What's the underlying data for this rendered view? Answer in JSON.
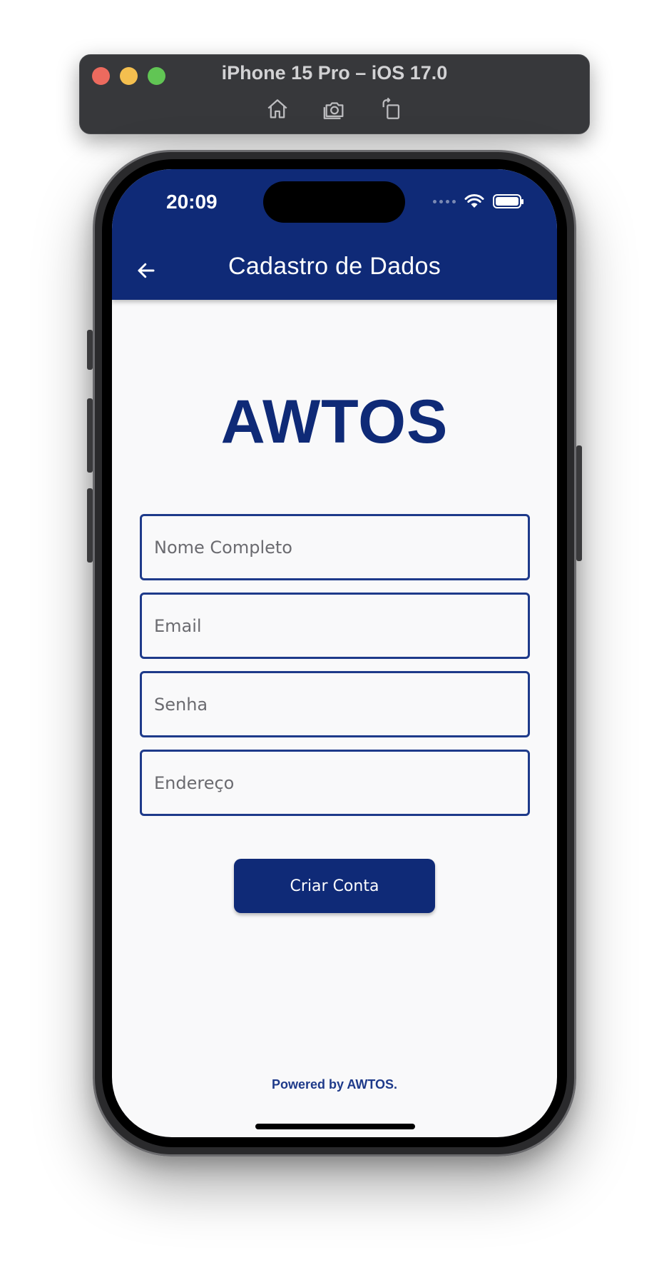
{
  "simulator": {
    "title": "iPhone 15 Pro – iOS 17.0",
    "tools": [
      "home-icon",
      "screenshot-icon",
      "rotate-icon"
    ]
  },
  "status_bar": {
    "time": "20:09"
  },
  "app_bar": {
    "title": "Cadastro de Dados",
    "back_icon": "arrow-left-icon"
  },
  "logo": {
    "text": "AWTOS"
  },
  "form": {
    "full_name_placeholder": "Nome Completo",
    "email_placeholder": "Email",
    "password_placeholder": "Senha",
    "address_placeholder": "Endereço",
    "submit_label": "Criar Conta"
  },
  "footer": {
    "text": "Powered by AWTOS."
  },
  "colors": {
    "primary": "#0f2a77",
    "background": "#f9f9fa",
    "field_border": "#1e3a8a"
  }
}
